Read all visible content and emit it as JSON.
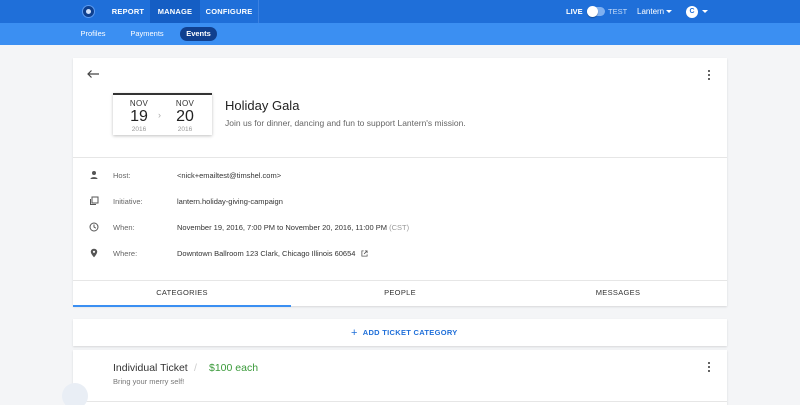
{
  "topbar": {
    "nav": [
      "REPORT",
      "MANAGE",
      "CONFIGURE"
    ],
    "live_label": "LIVE",
    "test_label": "TEST",
    "org_name": "Lantern",
    "avatar_initial": "C",
    "colors": {
      "primary": "#1f6fd9",
      "active_tab": "#155ec4"
    }
  },
  "subnav": {
    "tabs": [
      "Profiles",
      "Payments",
      "Events"
    ],
    "active": "Events"
  },
  "event": {
    "start": {
      "month": "NOV",
      "day": "19",
      "year": "2016"
    },
    "end": {
      "month": "NOV",
      "day": "20",
      "year": "2016"
    },
    "title": "Holiday Gala",
    "description": "Join us for dinner, dancing and fun to support Lantern's mission.",
    "details": {
      "host_label": "Host:",
      "host_value": "<nick+emailtest@timshel.com>",
      "initiative_label": "Initiative:",
      "initiative_value": "lantern.holiday-giving-campaign",
      "when_label": "When:",
      "when_value": "November 19, 2016, 7:00 PM to November 20, 2016, 11:00 PM",
      "when_tz": "(CST)",
      "where_label": "Where:",
      "where_value": "Downtown Ballroom 123 Clark, Chicago Illinois 60654"
    },
    "tabs": [
      "CATEGORIES",
      "PEOPLE",
      "MESSAGES"
    ],
    "active_tab": "CATEGORIES"
  },
  "add_ticket_label": "ADD TICKET CATEGORY",
  "ticket": {
    "name": "Individual Ticket",
    "separator": "/",
    "price": "$100 each",
    "description": "Bring your merry self!",
    "price_color": "#3a9a3a"
  }
}
